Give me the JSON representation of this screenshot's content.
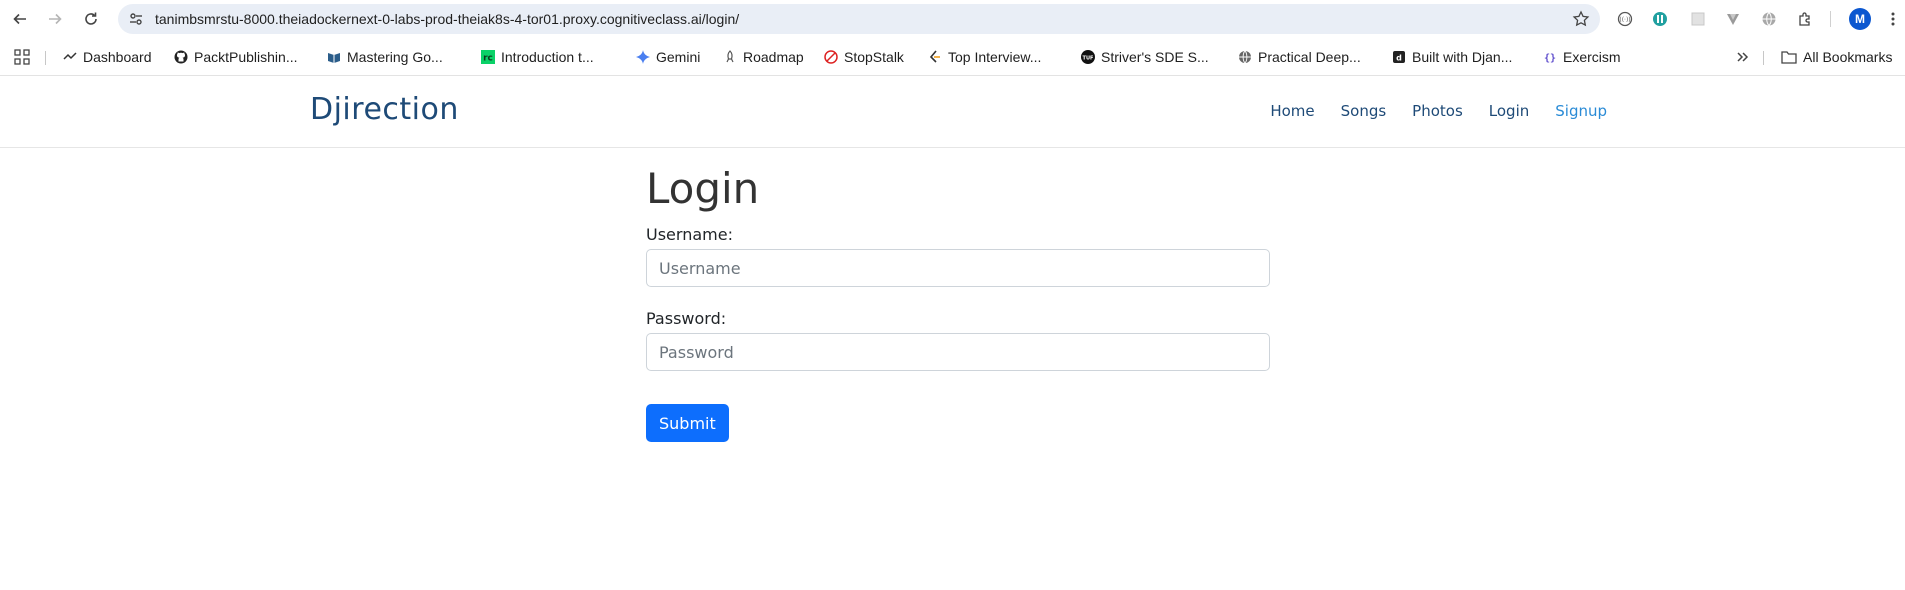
{
  "browser": {
    "url": "tanimbsmrstu-8000.theiadockernext-0-labs-prod-theiak8s-4-tor01.proxy.cognitiveclass.ai/login/",
    "profile_initial": "M",
    "bookmarks": [
      {
        "label": "Dashboard",
        "icon": "dashboard-icon"
      },
      {
        "label": "PacktPublishin...",
        "icon": "github-icon"
      },
      {
        "label": "Mastering Go...",
        "icon": "book-icon"
      },
      {
        "label": "Introduction t...",
        "icon": "rc-icon"
      },
      {
        "label": "Gemini",
        "icon": "gemini-icon"
      },
      {
        "label": "Roadmap",
        "icon": "rocket-icon"
      },
      {
        "label": "StopStalk",
        "icon": "stopstalk-icon"
      },
      {
        "label": "Top Interview...",
        "icon": "leetcode-icon"
      },
      {
        "label": "Striver's SDE S...",
        "icon": "tuf-icon"
      },
      {
        "label": "Practical Deep...",
        "icon": "globe-icon"
      },
      {
        "label": "Built with Djan...",
        "icon": "django-icon"
      },
      {
        "label": "Exercism",
        "icon": "exercism-icon"
      }
    ],
    "all_bookmarks_label": "All Bookmarks"
  },
  "site": {
    "brand": "Djirection",
    "nav": [
      {
        "label": "Home"
      },
      {
        "label": "Songs"
      },
      {
        "label": "Photos"
      },
      {
        "label": "Login"
      },
      {
        "label": "Signup"
      }
    ]
  },
  "login": {
    "title": "Login",
    "username_label": "Username:",
    "username_placeholder": "Username",
    "password_label": "Password:",
    "password_placeholder": "Password",
    "submit_label": "Submit"
  },
  "colors": {
    "brand": "#1e4a77",
    "nav_active": "#2a8bd6",
    "submit": "#0d6efd",
    "omnibox": "#e9eef6"
  }
}
